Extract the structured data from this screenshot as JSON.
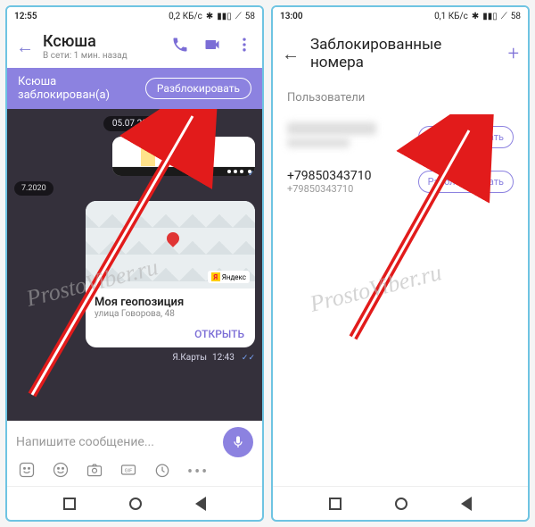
{
  "left": {
    "status": {
      "time": "12:55",
      "net": "0,2 КБ/с",
      "battery": "58"
    },
    "contact": {
      "name": "Ксюша",
      "presence": "В сети: 1 мин. назад"
    },
    "banner": {
      "text": "Ксюша заблокирован(а)",
      "button": "Разблокировать"
    },
    "dates": {
      "d1": "05.07.2020",
      "d2": "7.2020"
    },
    "unknown": ".07.2020",
    "location": {
      "title": "Моя геопозиция",
      "address": "улица Говорова, 48",
      "open": "ОТКРЫТЬ",
      "provider": "Яндекс"
    },
    "meta": {
      "source": "Я.Карты",
      "time": "12:43"
    },
    "composer": {
      "placeholder": "Напишите сообщение..."
    }
  },
  "right": {
    "status": {
      "time": "13:00",
      "net": "0,1 КБ/с",
      "battery": "58"
    },
    "title": "Заблокированные номера",
    "section": "Пользователи",
    "rows": [
      {
        "phone": "",
        "sub": "",
        "action": "Разблокировать"
      },
      {
        "phone": "+79850343710",
        "sub": "+79850343710",
        "action": "Разблокировать"
      }
    ]
  },
  "watermark": "ProstoViber.ru"
}
